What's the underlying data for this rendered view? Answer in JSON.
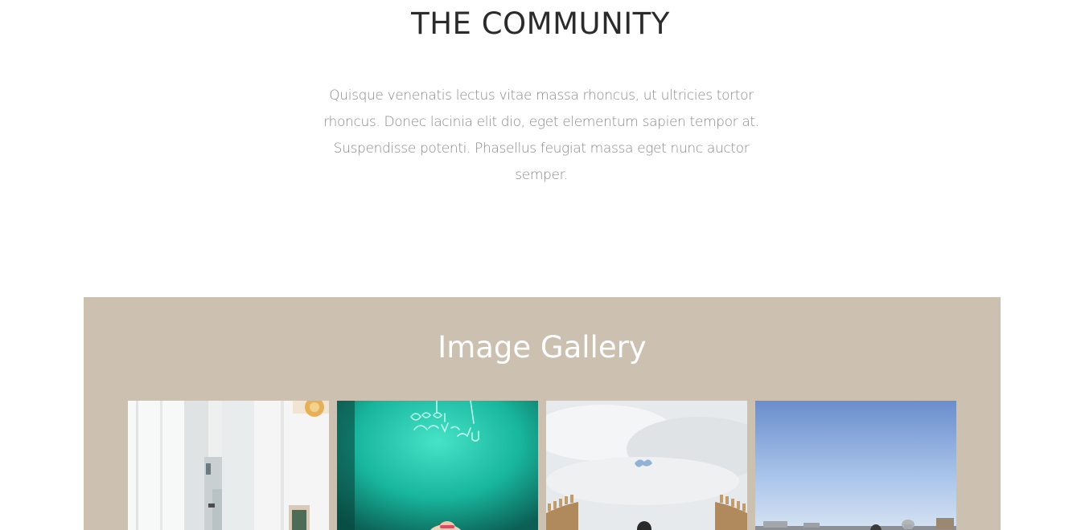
{
  "community": {
    "title": "THE COMMUNITY",
    "text": "Quisque venenatis lectus vitae massa rhoncus, ut ultricies tortor rhoncus. Donec lacinia elit dio, eget elementum sapien tempor at. Suspendisse potenti. Phasellus feugiat massa eget nunc auctor semper."
  },
  "gallery": {
    "title": "Image Gallery",
    "background": "#ccc0b0",
    "images": [
      {
        "subject": "white alley"
      },
      {
        "subject": "neon sign portrait"
      },
      {
        "subject": "cloudy sky walls"
      },
      {
        "subject": "blue sky city"
      }
    ]
  }
}
